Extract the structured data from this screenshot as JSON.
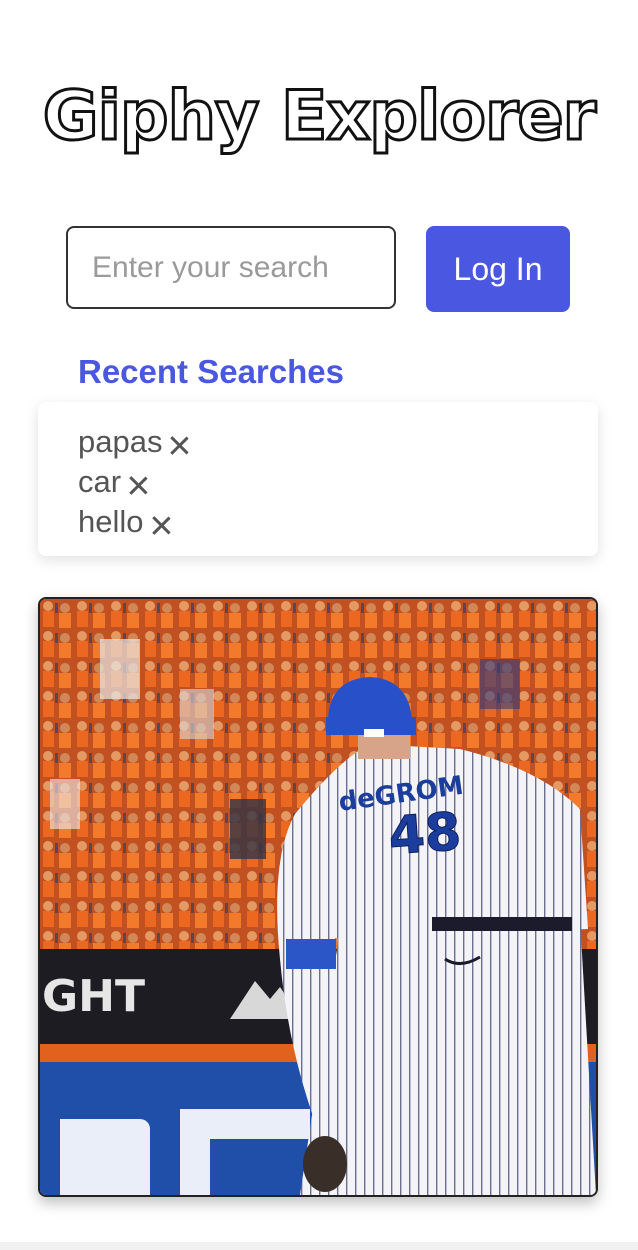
{
  "header": {
    "title": "Giphy Explorer"
  },
  "search": {
    "placeholder": "Enter your search",
    "value": ""
  },
  "auth": {
    "login_label": "Log In"
  },
  "recent": {
    "heading": "Recent Searches",
    "items": [
      {
        "term": "papas",
        "remove_icon": "close-icon"
      },
      {
        "term": "car",
        "remove_icon": "close-icon"
      },
      {
        "term": "hello",
        "remove_icon": "close-icon"
      }
    ]
  },
  "gif": {
    "jersey_number": "48",
    "jersey_name": "deGROM",
    "banner_text": "GHT"
  },
  "colors": {
    "accent": "#4a57e0",
    "title_stroke": "#111111",
    "recent_text": "#555555"
  }
}
